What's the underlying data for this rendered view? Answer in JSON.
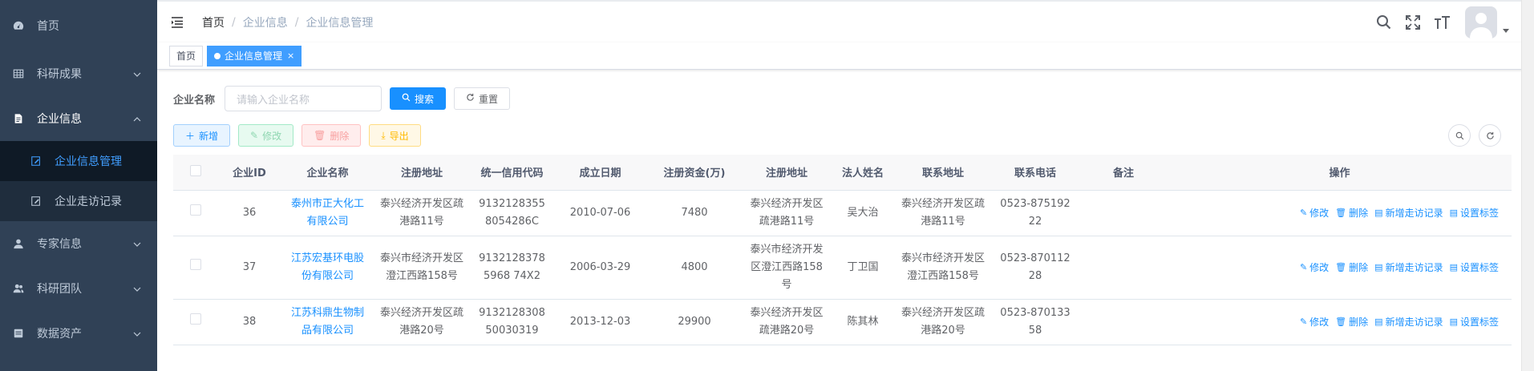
{
  "sidebar": {
    "items": [
      {
        "label": "首页",
        "icon": "dashboard-icon"
      },
      {
        "label": "科研成果",
        "icon": "table-icon"
      },
      {
        "label": "企业信息",
        "icon": "document-icon"
      },
      {
        "label": "专家信息",
        "icon": "user-icon"
      },
      {
        "label": "科研团队",
        "icon": "peoples-icon"
      },
      {
        "label": "数据资产",
        "icon": "server-icon"
      }
    ],
    "submenu": [
      {
        "label": "企业信息管理",
        "icon": "edit-icon"
      },
      {
        "label": "企业走访记录",
        "icon": "edit-icon"
      }
    ]
  },
  "breadcrumb": {
    "home": "首页",
    "level1": "企业信息",
    "level2": "企业信息管理",
    "sep": "/"
  },
  "tags": {
    "home": "首页",
    "active": "企业信息管理",
    "close": "×"
  },
  "search": {
    "label": "企业名称",
    "placeholder": "请输入企业名称",
    "search_btn": "搜索",
    "reset_btn": "重置"
  },
  "toolbar": {
    "add": "新增",
    "edit": "修改",
    "delete": "删除",
    "export": "导出"
  },
  "colors": {
    "sidebar_bg": "#304156",
    "primary": "#1890ff",
    "active_tag": "#409eff"
  },
  "table": {
    "headers": [
      "",
      "企业ID",
      "企业名称",
      "注册地址",
      "统一信用代码",
      "成立日期",
      "注册资金(万)",
      "注册地址",
      "法人姓名",
      "联系地址",
      "联系电话",
      "备注",
      "操作"
    ],
    "rows": [
      {
        "id": "36",
        "name": "泰州市正大化工有限公司",
        "reg_addr": "泰兴经济开发区疏港路11号",
        "credit": "91321283558054286C",
        "date": "2010-07-06",
        "capital": "7480",
        "reg_addr2": "泰兴经济开发区疏港路11号",
        "legal": "吴大治",
        "contact_addr": "泰兴经济开发区疏港路11号",
        "phone": "0523-87519222",
        "remark": ""
      },
      {
        "id": "37",
        "name": "江苏宏基环电股份有限公司",
        "reg_addr": "泰兴市经济开发区澄江西路158号",
        "credit": "91321283785968 74X2",
        "date": "2006-03-29",
        "capital": "4800",
        "reg_addr2": "泰兴市经济开发区澄江西路158号",
        "legal": "丁卫国",
        "contact_addr": "泰兴市经济开发区澄江西路158号",
        "phone": "0523-87011228",
        "remark": ""
      },
      {
        "id": "38",
        "name": "江苏科鼎生物制品有限公司",
        "reg_addr": "泰兴经济开发区疏港路20号",
        "credit": "913212830850030319",
        "date": "2013-12-03",
        "capital": "29900",
        "reg_addr2": "泰兴经济开发区疏港路20号",
        "legal": "陈其林",
        "contact_addr": "泰兴经济开发区疏港路20号",
        "phone": "0523-87013358",
        "remark": ""
      }
    ],
    "ops": {
      "edit": "修改",
      "delete": "删除",
      "add_visit": "新增走访记录",
      "set_tag": "设置标签"
    }
  }
}
